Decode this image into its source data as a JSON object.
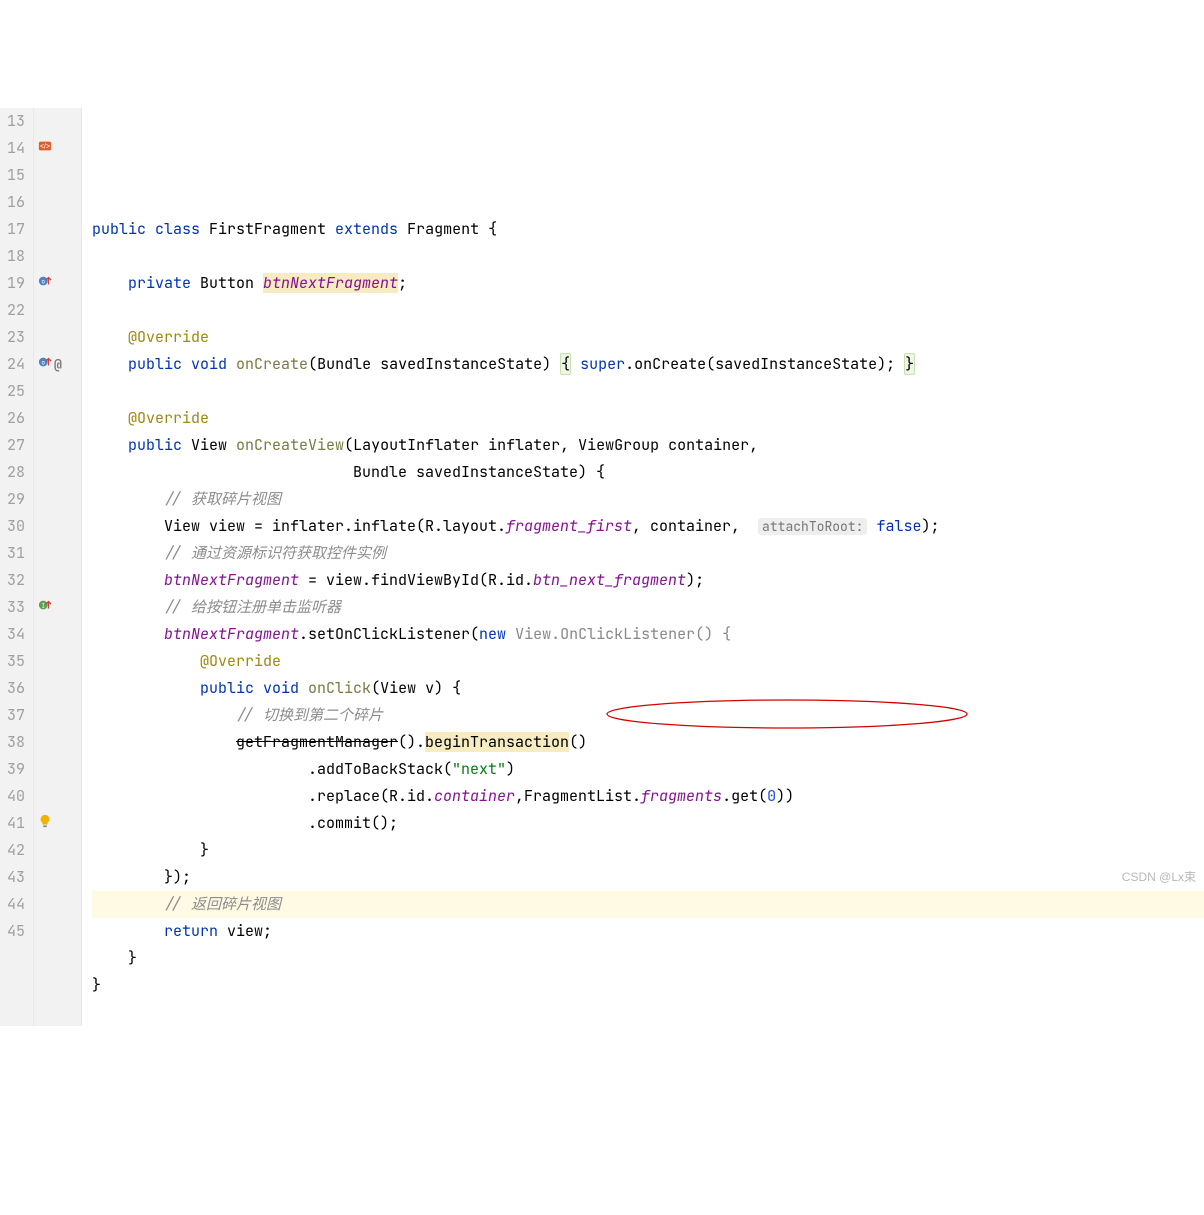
{
  "watermark": "CSDN @Lx束",
  "lines": [
    {
      "n": "13",
      "icons": [],
      "tokens": []
    },
    {
      "n": "14",
      "icons": [
        "class-icon"
      ],
      "tokens": [
        {
          "t": "public ",
          "c": "kw"
        },
        {
          "t": "class ",
          "c": "kw"
        },
        {
          "t": "FirstFragment ",
          "c": ""
        },
        {
          "t": "extends ",
          "c": "kw"
        },
        {
          "t": "Fragment {",
          "c": ""
        }
      ]
    },
    {
      "n": "15",
      "icons": [],
      "tokens": []
    },
    {
      "n": "16",
      "icons": [],
      "tokens": [
        {
          "t": "    ",
          "c": ""
        },
        {
          "t": "private ",
          "c": "kw"
        },
        {
          "t": "Button ",
          "c": ""
        },
        {
          "t": "btnNextFragment",
          "c": "fld hl-warn",
          "nostyleItalic": false
        },
        {
          "t": ";",
          "c": ""
        }
      ]
    },
    {
      "n": "17",
      "icons": [],
      "tokens": []
    },
    {
      "n": "18",
      "icons": [],
      "tokens": [
        {
          "t": "    ",
          "c": ""
        },
        {
          "t": "@Override",
          "c": "ann"
        }
      ]
    },
    {
      "n": "19",
      "icons": [
        "override-up-icon"
      ],
      "tokens": [
        {
          "t": "    ",
          "c": ""
        },
        {
          "t": "public ",
          "c": "kw"
        },
        {
          "t": "void ",
          "c": "kw"
        },
        {
          "t": "onCreate",
          "c": "mth"
        },
        {
          "t": "(Bundle savedInstanceState) ",
          "c": ""
        },
        {
          "t": "{",
          "c": "hl-box"
        },
        {
          "t": " ",
          "c": ""
        },
        {
          "t": "super",
          "c": "kw"
        },
        {
          "t": ".onCreate(savedInstanceState); ",
          "c": ""
        },
        {
          "t": "}",
          "c": "hl-box"
        }
      ]
    },
    {
      "n": "22",
      "icons": [],
      "tokens": []
    },
    {
      "n": "23",
      "icons": [],
      "tokens": [
        {
          "t": "    ",
          "c": ""
        },
        {
          "t": "@Override",
          "c": "ann"
        }
      ]
    },
    {
      "n": "24",
      "icons": [
        "override-up-icon",
        "at-icon"
      ],
      "tokens": [
        {
          "t": "    ",
          "c": ""
        },
        {
          "t": "public ",
          "c": "kw"
        },
        {
          "t": "View ",
          "c": ""
        },
        {
          "t": "onCreateView",
          "c": "mth"
        },
        {
          "t": "(LayoutInflater inflater, ViewGroup container,",
          "c": ""
        }
      ]
    },
    {
      "n": "25",
      "icons": [],
      "tokens": [
        {
          "t": "                             Bundle savedInstanceState) {",
          "c": ""
        }
      ]
    },
    {
      "n": "26",
      "icons": [],
      "tokens": [
        {
          "t": "        ",
          "c": ""
        },
        {
          "t": "// 获取碎片视图",
          "c": "cmt"
        }
      ]
    },
    {
      "n": "27",
      "icons": [],
      "tokens": [
        {
          "t": "        View view = inflater.inflate(R.layout.",
          "c": ""
        },
        {
          "t": "fragment_first",
          "c": "fld"
        },
        {
          "t": ", container,  ",
          "c": ""
        },
        {
          "t": "attachToRoot:",
          "c": "hint"
        },
        {
          "t": " ",
          "c": ""
        },
        {
          "t": "false",
          "c": "kw"
        },
        {
          "t": ");",
          "c": ""
        }
      ]
    },
    {
      "n": "28",
      "icons": [],
      "tokens": [
        {
          "t": "        ",
          "c": ""
        },
        {
          "t": "// 通过资源标识符获取控件实例",
          "c": "cmt"
        }
      ]
    },
    {
      "n": "29",
      "icons": [],
      "tokens": [
        {
          "t": "        ",
          "c": ""
        },
        {
          "t": "btnNextFragment",
          "c": "fld"
        },
        {
          "t": " = view.findViewById(R.id.",
          "c": ""
        },
        {
          "t": "btn_next_fragment",
          "c": "fld"
        },
        {
          "t": ");",
          "c": ""
        }
      ]
    },
    {
      "n": "30",
      "icons": [],
      "tokens": [
        {
          "t": "        ",
          "c": ""
        },
        {
          "t": "// 给按钮注册单击监听器",
          "c": "cmt"
        }
      ]
    },
    {
      "n": "31",
      "icons": [],
      "tokens": [
        {
          "t": "        ",
          "c": ""
        },
        {
          "t": "btnNextFragment",
          "c": "fld"
        },
        {
          "t": ".setOnClickListener(",
          "c": ""
        },
        {
          "t": "new ",
          "c": "kw"
        },
        {
          "t": "View.OnClickListener() {",
          "c": "param",
          "style": "color:#888"
        }
      ]
    },
    {
      "n": "32",
      "icons": [],
      "tokens": [
        {
          "t": "            ",
          "c": ""
        },
        {
          "t": "@Override",
          "c": "ann"
        }
      ]
    },
    {
      "n": "33",
      "icons": [
        "impl-up-icon"
      ],
      "tokens": [
        {
          "t": "            ",
          "c": ""
        },
        {
          "t": "public ",
          "c": "kw"
        },
        {
          "t": "void ",
          "c": "kw"
        },
        {
          "t": "onClick",
          "c": "mth"
        },
        {
          "t": "(View v) {",
          "c": ""
        }
      ]
    },
    {
      "n": "34",
      "icons": [],
      "tokens": [
        {
          "t": "                ",
          "c": ""
        },
        {
          "t": "// 切换到第二个碎片",
          "c": "cmt"
        }
      ]
    },
    {
      "n": "35",
      "icons": [],
      "tokens": [
        {
          "t": "                ",
          "c": ""
        },
        {
          "t": "getFragmentManager",
          "c": "strike"
        },
        {
          "t": "().",
          "c": ""
        },
        {
          "t": "beginTransaction",
          "c": "hl-warn"
        },
        {
          "t": "()",
          "c": ""
        }
      ]
    },
    {
      "n": "36",
      "icons": [],
      "tokens": [
        {
          "t": "                        .addToBackStack(",
          "c": ""
        },
        {
          "t": "\"next\"",
          "c": "str"
        },
        {
          "t": ")",
          "c": ""
        }
      ]
    },
    {
      "n": "37",
      "icons": [],
      "tokens": [
        {
          "t": "                        .replace(R.id.",
          "c": ""
        },
        {
          "t": "container",
          "c": "fld"
        },
        {
          "t": ",FragmentList.",
          "c": ""
        },
        {
          "t": "fragments",
          "c": "fld"
        },
        {
          "t": ".get(",
          "c": ""
        },
        {
          "t": "0",
          "c": "num"
        },
        {
          "t": "))",
          "c": ""
        }
      ]
    },
    {
      "n": "38",
      "icons": [],
      "tokens": [
        {
          "t": "                        .commit();",
          "c": ""
        }
      ]
    },
    {
      "n": "39",
      "icons": [],
      "tokens": [
        {
          "t": "            }",
          "c": ""
        }
      ]
    },
    {
      "n": "40",
      "icons": [],
      "tokens": [
        {
          "t": "        });",
          "c": ""
        }
      ]
    },
    {
      "n": "41",
      "icons": [
        "bulb-icon"
      ],
      "tokens": [
        {
          "t": "        ",
          "c": ""
        },
        {
          "t": "// 返回碎片视图",
          "c": "cmt"
        }
      ],
      "caret": true
    },
    {
      "n": "42",
      "icons": [],
      "tokens": [
        {
          "t": "        ",
          "c": ""
        },
        {
          "t": "return ",
          "c": "kw"
        },
        {
          "t": "view;",
          "c": ""
        }
      ]
    },
    {
      "n": "43",
      "icons": [],
      "tokens": [
        {
          "t": "    }",
          "c": ""
        }
      ]
    },
    {
      "n": "44",
      "icons": [],
      "tokens": [
        {
          "t": "}",
          "c": ""
        }
      ]
    },
    {
      "n": "45",
      "icons": [],
      "tokens": []
    }
  ]
}
